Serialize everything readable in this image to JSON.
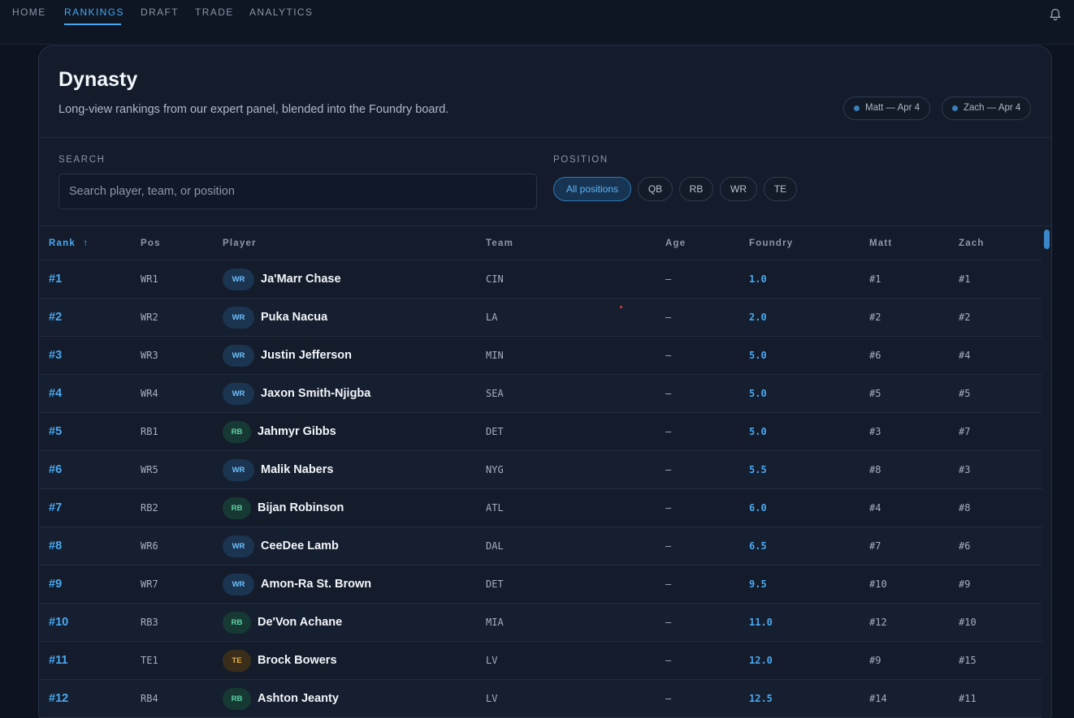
{
  "nav": {
    "items": [
      {
        "label": "HOME"
      },
      {
        "label": "RANKINGS",
        "active": true
      },
      {
        "label": "DRAFT"
      },
      {
        "label": "TRADE"
      },
      {
        "label": "ANALYTICS"
      }
    ],
    "bell_icon": "bell-icon"
  },
  "header": {
    "title": "Dynasty",
    "subtitle": "Long-view rankings from our expert panel, blended into the Foundry board.",
    "chips": [
      {
        "label": "Matt — Apr 4"
      },
      {
        "label": "Zach — Apr 4"
      }
    ]
  },
  "filters": {
    "search_label": "SEARCH",
    "search_placeholder": "Search player, team, or position",
    "position_label": "POSITION",
    "positions": [
      "All positions",
      "QB",
      "RB",
      "WR",
      "TE"
    ],
    "active_position": "All positions"
  },
  "table": {
    "columns": [
      "Rank",
      "Pos",
      "Player",
      "Team",
      "Age",
      "Foundry",
      "Matt",
      "Zach"
    ],
    "sort_indicator": "↑",
    "rows": [
      {
        "rank": "#1",
        "pos": "WR1",
        "badge": "WR",
        "player": "Ja'Marr Chase",
        "team": "CIN",
        "age": "—",
        "foundry": "1.0",
        "matt": "#1",
        "zach": "#1"
      },
      {
        "rank": "#2",
        "pos": "WR2",
        "badge": "WR",
        "player": "Puka Nacua",
        "team": "LA",
        "age": "—",
        "foundry": "2.0",
        "matt": "#2",
        "zach": "#2"
      },
      {
        "rank": "#3",
        "pos": "WR3",
        "badge": "WR",
        "player": "Justin Jefferson",
        "team": "MIN",
        "age": "—",
        "foundry": "5.0",
        "matt": "#6",
        "zach": "#4"
      },
      {
        "rank": "#4",
        "pos": "WR4",
        "badge": "WR",
        "player": "Jaxon Smith-Njigba",
        "team": "SEA",
        "age": "—",
        "foundry": "5.0",
        "matt": "#5",
        "zach": "#5"
      },
      {
        "rank": "#5",
        "pos": "RB1",
        "badge": "RB",
        "player": "Jahmyr Gibbs",
        "team": "DET",
        "age": "—",
        "foundry": "5.0",
        "matt": "#3",
        "zach": "#7"
      },
      {
        "rank": "#6",
        "pos": "WR5",
        "badge": "WR",
        "player": "Malik Nabers",
        "team": "NYG",
        "age": "—",
        "foundry": "5.5",
        "matt": "#8",
        "zach": "#3"
      },
      {
        "rank": "#7",
        "pos": "RB2",
        "badge": "RB",
        "player": "Bijan Robinson",
        "team": "ATL",
        "age": "—",
        "foundry": "6.0",
        "matt": "#4",
        "zach": "#8"
      },
      {
        "rank": "#8",
        "pos": "WR6",
        "badge": "WR",
        "player": "CeeDee Lamb",
        "team": "DAL",
        "age": "—",
        "foundry": "6.5",
        "matt": "#7",
        "zach": "#6"
      },
      {
        "rank": "#9",
        "pos": "WR7",
        "badge": "WR",
        "player": "Amon-Ra St. Brown",
        "team": "DET",
        "age": "—",
        "foundry": "9.5",
        "matt": "#10",
        "zach": "#9"
      },
      {
        "rank": "#10",
        "pos": "RB3",
        "badge": "RB",
        "player": "De'Von Achane",
        "team": "MIA",
        "age": "—",
        "foundry": "11.0",
        "matt": "#12",
        "zach": "#10"
      },
      {
        "rank": "#11",
        "pos": "TE1",
        "badge": "TE",
        "player": "Brock Bowers",
        "team": "LV",
        "age": "—",
        "foundry": "12.0",
        "matt": "#9",
        "zach": "#15"
      },
      {
        "rank": "#12",
        "pos": "RB4",
        "badge": "RB",
        "player": "Ashton Jeanty",
        "team": "LV",
        "age": "—",
        "foundry": "12.5",
        "matt": "#14",
        "zach": "#11"
      }
    ]
  }
}
